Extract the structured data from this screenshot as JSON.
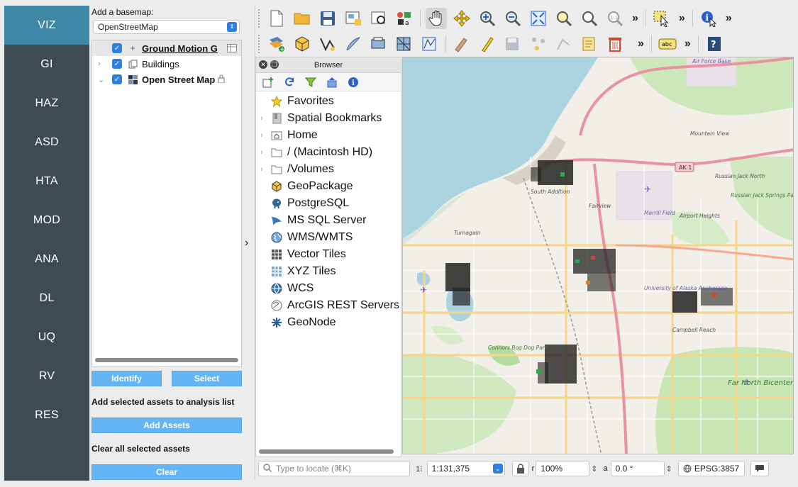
{
  "nav": {
    "items": [
      {
        "label": "VIZ",
        "active": true
      },
      {
        "label": "GI"
      },
      {
        "label": "HAZ"
      },
      {
        "label": "ASD"
      },
      {
        "label": "HTA"
      },
      {
        "label": "MOD"
      },
      {
        "label": "ANA"
      },
      {
        "label": "DL"
      },
      {
        "label": "UQ"
      },
      {
        "label": "RV"
      },
      {
        "label": "RES"
      }
    ]
  },
  "layers_panel": {
    "basemap_label": "Add a basemap:",
    "basemap_value": "OpenStreetMap",
    "layers": [
      {
        "name": "Ground Motion G",
        "checked": true
      },
      {
        "name": "Buildings",
        "checked": true
      },
      {
        "name": "Open Street Map",
        "checked": true
      }
    ],
    "identify_button": "Identify",
    "select_button": "Select",
    "add_label": "Add selected assets to analysis list",
    "add_button": "Add Assets",
    "clear_label": "Clear all selected assets",
    "clear_button": "Clear"
  },
  "browser": {
    "title": "Browser",
    "items": [
      {
        "label": "Favorites",
        "icon": "star-icon",
        "expandable": false
      },
      {
        "label": "Spatial Bookmarks",
        "icon": "bookmark-icon",
        "expandable": true
      },
      {
        "label": "Home",
        "icon": "home-folder-icon",
        "expandable": true
      },
      {
        "label": "/ (Macintosh HD)",
        "icon": "folder-icon",
        "expandable": true
      },
      {
        "label": "/Volumes",
        "icon": "folder-icon",
        "expandable": true
      },
      {
        "label": "GeoPackage",
        "icon": "geopackage-icon",
        "expandable": false
      },
      {
        "label": "PostgreSQL",
        "icon": "postgresql-icon",
        "expandable": false
      },
      {
        "label": "MS SQL Server",
        "icon": "mssql-icon",
        "expandable": false
      },
      {
        "label": "WMS/WMTS",
        "icon": "globe-icon",
        "expandable": false
      },
      {
        "label": "Vector Tiles",
        "icon": "vector-tiles-icon",
        "expandable": false
      },
      {
        "label": "XYZ Tiles",
        "icon": "xyz-tiles-icon",
        "expandable": false
      },
      {
        "label": "WCS",
        "icon": "globe-icon",
        "expandable": false
      },
      {
        "label": "ArcGIS REST Servers",
        "icon": "arcgis-icon",
        "expandable": false
      },
      {
        "label": "GeoNode",
        "icon": "geonode-icon",
        "expandable": false
      }
    ]
  },
  "map_labels": [
    "Air Force Base",
    "Mountain View",
    "AK 1",
    "Russian Jack North",
    "Merrill Field",
    "Russian Jack Springs Park",
    "South Addition",
    "Fairview",
    "Airport Heights",
    "Turnagain",
    "University of Alaska Anchorage",
    "Campbell Reach",
    "Connors Bog Dog Park",
    "Far North Bicentennial Park"
  ],
  "statusbar": {
    "locate_placeholder": "Type to locate (⌘K)",
    "scale_value": "1:131,375",
    "magnifier_value": "100%",
    "rotation_value": "0.0 °",
    "crs": "EPSG:3857"
  },
  "colors": {
    "nav_bg": "#3e4b53",
    "nav_active": "#3f87a6",
    "button_blue": "#64b5f6",
    "checkbox_blue": "#2f7fe0",
    "water": "#aad3df",
    "park": "#c8e6b4"
  }
}
